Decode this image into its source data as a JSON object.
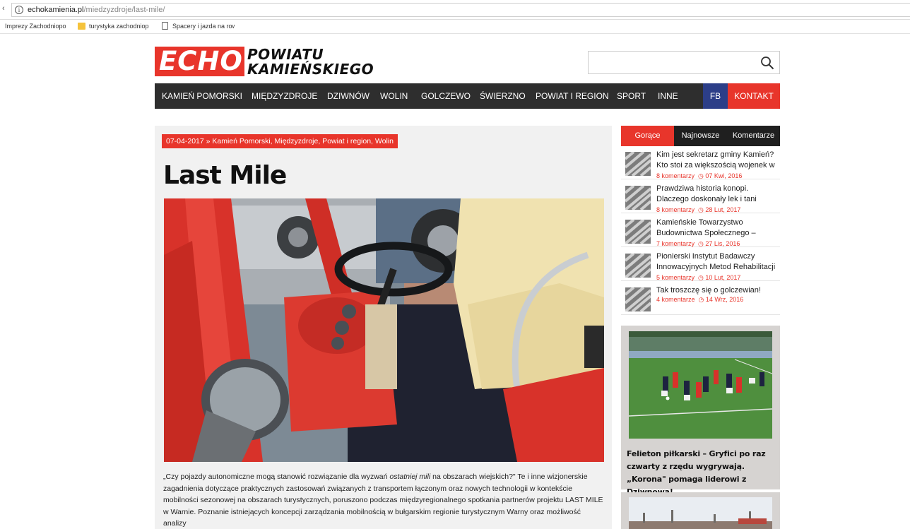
{
  "browser": {
    "url_host": "echokamienia.pl",
    "url_path": "/miedzyzdroje/last-mile/",
    "bookmarks": [
      "Imprezy Zachodniopo",
      "turystyka zachodniop",
      "Spacery i jazda na row"
    ]
  },
  "site": {
    "logo_main": "ECHO",
    "logo_line1": "POWIATU",
    "logo_line2": "KAMIEŃSKIEGO"
  },
  "nav": {
    "items": [
      "KAMIEŃ POMORSKI",
      "MIĘDZYZDROJE",
      "DZIWNÓW",
      "WOLIN",
      "GOLCZEWO",
      "ŚWIERZNO",
      "POWIAT I REGION",
      "SPORT",
      "INNE"
    ],
    "fb": "FB",
    "kontakt": "KONTAKT"
  },
  "article": {
    "meta": "07-04-2017 » Kamień Pomorski, Międzyzdroje, Powiat i region, Wolin",
    "title": "Last Mile",
    "body_pre": "„Czy pojazdy autonomiczne mogą stanowić rozwiązanie dla wyzwań ",
    "body_em": "ostatniej mili",
    "body_post": " na obszarach wiejskich?\" Te i inne wizjonerskie zagadnienia dotyczące praktycznych zastosowań związanych z transportem łączonym oraz nowych technologii w kontekście mobilności sezonowej na obszarach turystycznych, poruszono podczas międzyregionalnego spotkania partnerów projektu LAST MILE w Warnie. Poznanie istniejących koncepcji zarządzania mobilnością w bułgarskim regionie turystycznym Warny oraz możliwość analizy"
  },
  "sidebar": {
    "tabs": [
      "Gorące",
      "Najnowsze",
      "Komentarze"
    ],
    "posts": [
      {
        "title": "Kim jest sekretarz gminy Kamień? Kto stoi za większością wojenek w",
        "comments": "8 komentarzy",
        "date": "07 Kwi, 2016"
      },
      {
        "title": "Prawdziwa historia konopi. Dlaczego doskonały lek i tani",
        "comments": "8 komentarzy",
        "date": "28 Lut, 2017"
      },
      {
        "title": "Kamieńskie Towarzystwo Budownictwa Społecznego –",
        "comments": "7 komentarzy",
        "date": "27 Lis, 2016"
      },
      {
        "title": "Pionierski Instytut Badawczy Innowacyjnych Metod Rehabilitacji",
        "comments": "5 komentarzy",
        "date": "10 Lut, 2017"
      },
      {
        "title": "Tak troszczę się o golczewian!",
        "comments": "4 komentarze",
        "date": "14 Wrz, 2016"
      }
    ],
    "feature_title": "Felieton piłkarski – Gryfici po raz czwarty z rzędu wygrywają. „Korona\" pomaga liderowi z Dziwnowa!"
  },
  "colors": {
    "brand_red": "#e8352b",
    "nav_dark": "#2e2e2e",
    "fb_blue": "#2c3e88"
  }
}
